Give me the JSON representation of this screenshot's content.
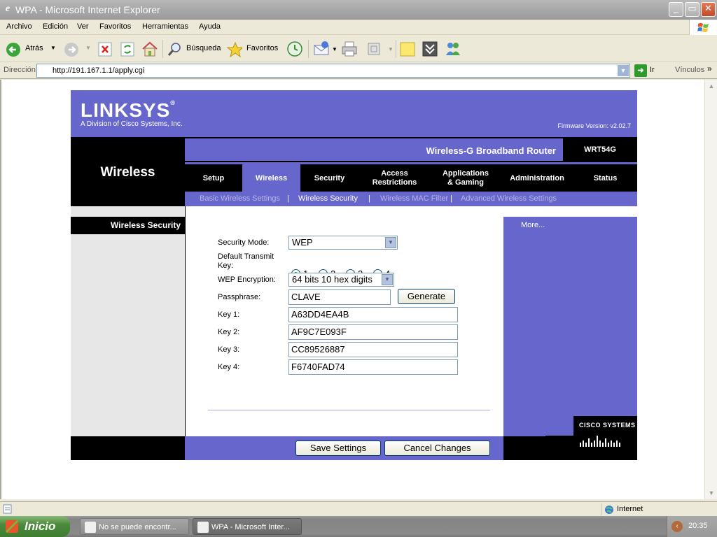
{
  "window": {
    "title": "WPA - Microsoft Internet Explorer"
  },
  "menu": [
    "Archivo",
    "Edición",
    "Ver",
    "Favoritos",
    "Herramientas",
    "Ayuda"
  ],
  "toolbar": {
    "back": "Atrás",
    "search": "Búsqueda",
    "favorites": "Favoritos"
  },
  "address": {
    "label": "Dirección",
    "url": "http://191.167.1.1/apply.cgi",
    "go": "Ir",
    "links": "Vínculos"
  },
  "page": {
    "logo": "LINKSYS",
    "logo_reg": "®",
    "logo_sub": "A Division of Cisco Systems, Inc.",
    "firmware": "Firmware Version: v2.02.7",
    "product": "Wireless-G Broadband Router",
    "model": "WRT54G",
    "section": "Wireless",
    "tabs": [
      "Setup",
      "Wireless",
      "Security",
      "Access\nRestrictions",
      "Applications\n& Gaming",
      "Administration",
      "Status"
    ],
    "subtabs": [
      "Basic Wireless Settings",
      "Wireless Security",
      "Wireless MAC Filter",
      "Advanced Wireless Settings"
    ],
    "subsep": "|",
    "left_label": "Wireless Security",
    "more": "More...",
    "cisco": "CISCO SYSTEMS",
    "form": {
      "security_mode_label": "Security Mode:",
      "security_mode": "WEP",
      "default_key_label": "Default Transmit Key:",
      "keys": [
        "1",
        "2",
        "3",
        "4"
      ],
      "selected_key": "1",
      "encryption_label": "WEP Encryption:",
      "encryption": "64 bits 10 hex digits",
      "passphrase_label": "Passphrase:",
      "passphrase": "CLAVE",
      "generate": "Generate",
      "key1_label": "Key 1:",
      "key1": "A63DD4EA4B",
      "key2_label": "Key 2:",
      "key2": "AF9C7E093F",
      "key3_label": "Key 3:",
      "key3": "CC89526887",
      "key4_label": "Key 4:",
      "key4": "F6740FAD74"
    },
    "save": "Save Settings",
    "cancel": "Cancel Changes"
  },
  "status": {
    "zone": "Internet"
  },
  "taskbar": {
    "start": "Inicio",
    "tasks": [
      "No se puede encontr...",
      "WPA - Microsoft Inter..."
    ],
    "clock": "20:35"
  },
  "colors": {
    "linksys_purple": "#6666cc",
    "xp_start_green": "#3f7d31"
  }
}
